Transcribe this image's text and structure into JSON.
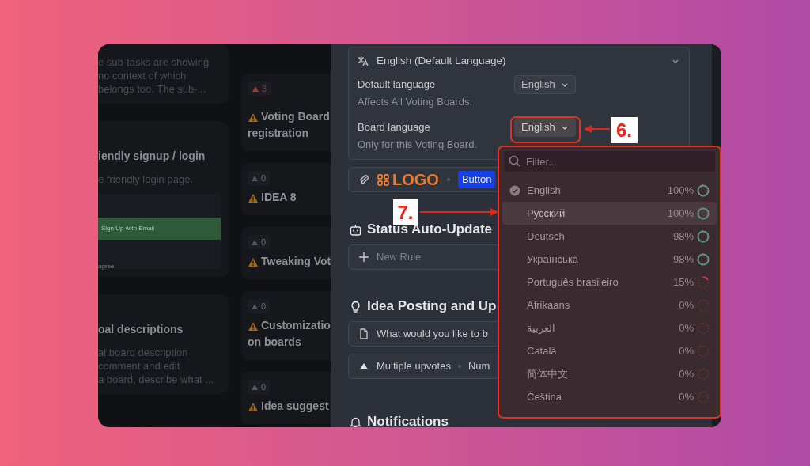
{
  "board": {
    "column_1": [
      {
        "description": [
          "e sub-tasks are showing",
          "no context of which",
          "belongs too. The sub-..."
        ]
      },
      {
        "title": "iendly signup / login",
        "description": [
          "e friendly login page."
        ],
        "preview": {
          "button": "Sign Up with Email",
          "footer": "agree"
        }
      },
      {
        "title": "oal descriptions",
        "description": [
          "al board description",
          "comment and edit",
          "a board, describe what ..."
        ]
      }
    ],
    "column_2": [
      {
        "votes": "3",
        "alert": true,
        "title_lines": [
          "Voting Board",
          "registration"
        ]
      },
      {
        "votes": "0",
        "alert": false,
        "title_lines": [
          "IDEA 8"
        ]
      },
      {
        "votes": "0",
        "alert": false,
        "title_lines": [
          "Tweaking Vot"
        ]
      },
      {
        "votes": "0",
        "alert": false,
        "title_lines": [
          "Customizatio",
          "on boards"
        ]
      },
      {
        "votes": "0",
        "alert": false,
        "title_lines": [
          "Idea suggest"
        ]
      }
    ]
  },
  "language_card": {
    "title": "English (Default Language)",
    "settings": [
      {
        "label": "Default language",
        "hint": "Affects All Voting Boards.",
        "value": "English",
        "open": false
      },
      {
        "label": "Board language",
        "hint": "Only for this Voting Board.",
        "value": "English",
        "open": true
      }
    ]
  },
  "logo_row": {
    "logo": "LOGO",
    "button": "Button"
  },
  "sections": [
    {
      "kind": "automation",
      "title": "Status Auto-Update",
      "rows": [
        {
          "kind": "add",
          "text": "New Rule"
        }
      ]
    },
    {
      "kind": "idea",
      "title": "Idea Posting and Up",
      "rows": [
        {
          "kind": "doc",
          "text": "What would you like to b"
        },
        {
          "kind": "upvote",
          "text": "Multiple upvotes",
          "extra": "Num"
        }
      ]
    },
    {
      "kind": "bell",
      "title": "Notifications"
    }
  ],
  "language_menu": {
    "placeholder": "Filter...",
    "items": [
      {
        "name": "English",
        "percent": "100%",
        "level": 1,
        "selected": true,
        "hovered": false
      },
      {
        "name": "Русский",
        "percent": "100%",
        "level": 1,
        "selected": false,
        "hovered": true
      },
      {
        "name": "Deutsch",
        "percent": "98%",
        "level": 0.98,
        "selected": false,
        "hovered": false
      },
      {
        "name": "Українська",
        "percent": "98%",
        "level": 0.98,
        "selected": false,
        "hovered": false
      },
      {
        "name": "Português brasileiro",
        "percent": "15%",
        "level": 0.15,
        "selected": false,
        "hovered": false
      },
      {
        "name": "Afrikaans",
        "percent": "0%",
        "level": 0,
        "selected": false,
        "hovered": false
      },
      {
        "name": "العربية",
        "percent": "0%",
        "level": 0,
        "selected": false,
        "hovered": false
      },
      {
        "name": "Català",
        "percent": "0%",
        "level": 0,
        "selected": false,
        "hovered": false
      },
      {
        "name": "简体中文",
        "percent": "0%",
        "level": 0,
        "selected": false,
        "hovered": false
      },
      {
        "name": "Čeština",
        "percent": "0%",
        "level": 0,
        "selected": false,
        "hovered": false
      }
    ]
  },
  "annotations": [
    {
      "label": "6."
    },
    {
      "label": "7."
    }
  ]
}
